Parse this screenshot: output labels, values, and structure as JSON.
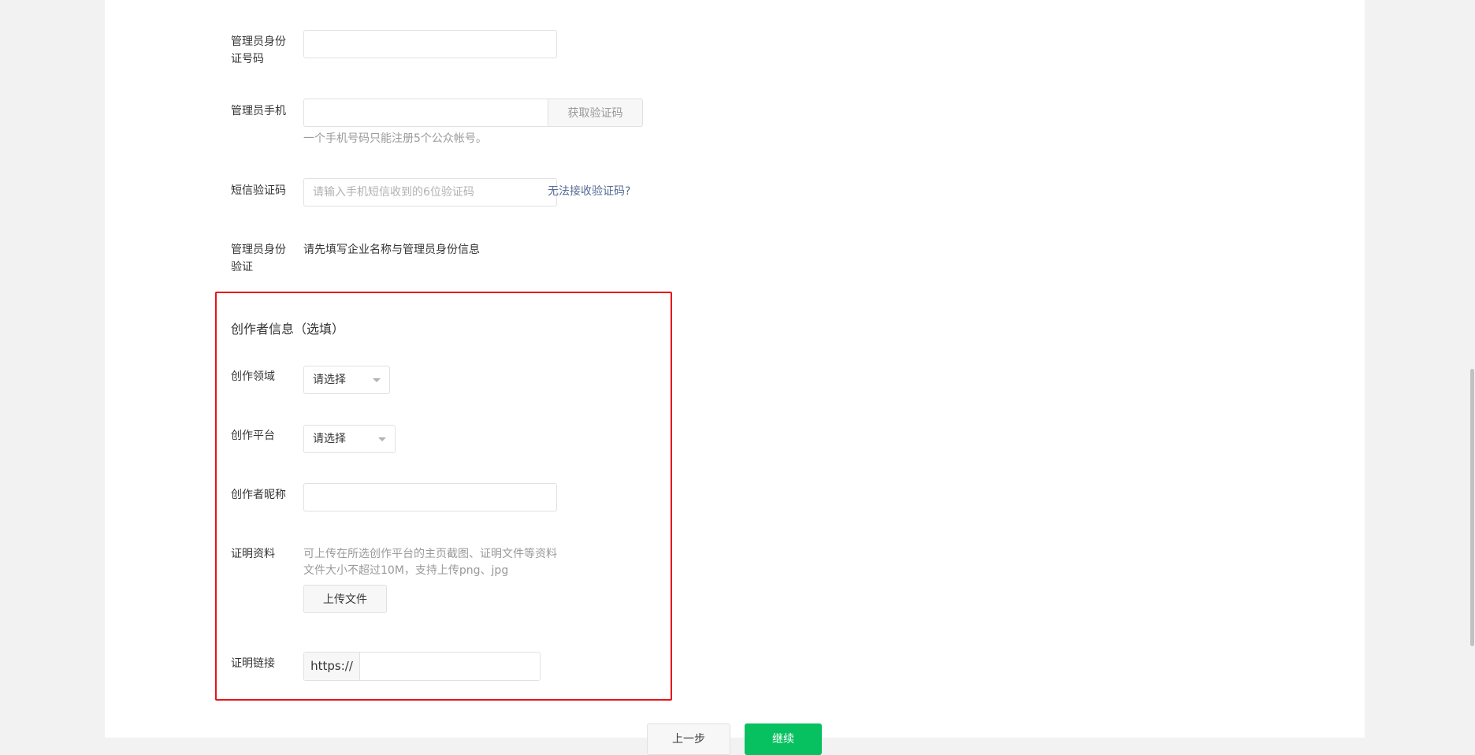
{
  "form": {
    "admin_id": {
      "label": "管理员身份证号码",
      "value": "",
      "placeholder": ""
    },
    "admin_phone": {
      "label": "管理员手机",
      "value": "",
      "placeholder": "",
      "get_code_label": "获取验证码",
      "tip": "一个手机号码只能注册5个公众帐号。"
    },
    "sms_code": {
      "label": "短信验证码",
      "placeholder": "请输入手机短信收到的6位验证码",
      "help_link": "无法接收验证码?"
    },
    "admin_verify": {
      "label": "管理员身份验证",
      "text": "请先填写企业名称与管理员身份信息"
    }
  },
  "creator": {
    "section_title": "创作者信息（选填）",
    "field": {
      "label": "创作领域",
      "selected": "请选择"
    },
    "platform": {
      "label": "创作平台",
      "selected": "请选择"
    },
    "nickname": {
      "label": "创作者昵称",
      "value": ""
    },
    "proof": {
      "label": "证明资料",
      "tip_line1": "可上传在所选创作平台的主页截图、证明文件等资料",
      "tip_line2": "文件大小不超过10M，支持上传png、jpg",
      "upload_label": "上传文件"
    },
    "proof_link": {
      "label": "证明链接",
      "prefix": "https://",
      "value": ""
    }
  },
  "footer": {
    "prev_label": "上一步",
    "next_label": "继续"
  },
  "colors": {
    "accent_green": "#07c160",
    "link_blue": "#576b95",
    "highlight_red": "#e8131a"
  }
}
